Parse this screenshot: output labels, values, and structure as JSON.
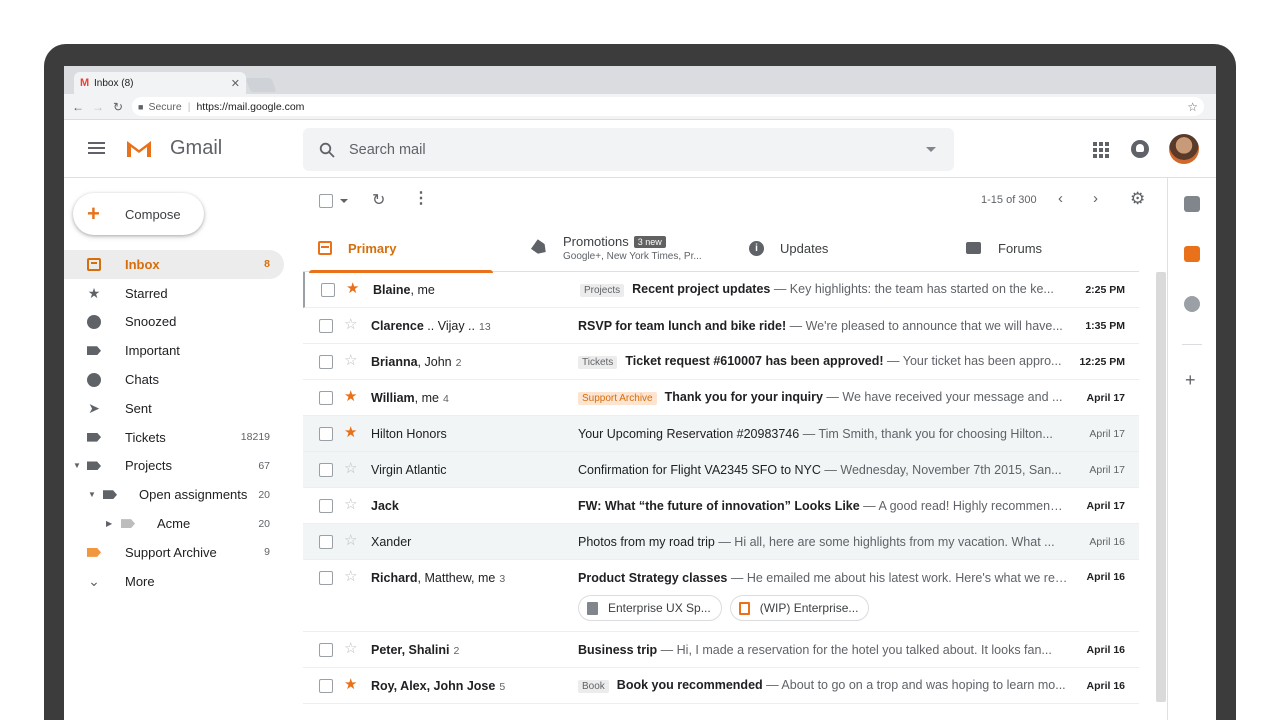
{
  "browser": {
    "tab_title": "Inbox (8)",
    "secure_label": "Secure",
    "url": "https://mail.google.com"
  },
  "app": {
    "name": "Gmail",
    "search_placeholder": "Search mail"
  },
  "compose_label": "Compose",
  "nav": [
    {
      "label": "Inbox",
      "count": "8"
    },
    {
      "label": "Starred",
      "count": ""
    },
    {
      "label": "Snoozed",
      "count": ""
    },
    {
      "label": "Important",
      "count": ""
    },
    {
      "label": "Chats",
      "count": ""
    },
    {
      "label": "Sent",
      "count": ""
    },
    {
      "label": "Tickets",
      "count": "18219"
    },
    {
      "label": "Projects",
      "count": "67"
    },
    {
      "label": "Open assignments",
      "count": "20"
    },
    {
      "label": "Acme",
      "count": "20"
    },
    {
      "label": "Support Archive",
      "count": "9"
    },
    {
      "label": "More",
      "count": ""
    }
  ],
  "toolbar": {
    "pagination": "1-15 of 300"
  },
  "tabs": {
    "primary": "Primary",
    "promotions": "Promotions",
    "promotions_badge": "3 new",
    "promotions_sub": "Google+, New York Times, Pr...",
    "updates": "Updates",
    "forums": "Forums"
  },
  "emails": [
    {
      "sender": "Blaine",
      "sender_rest": ", me",
      "count": "",
      "chip": "Projects",
      "subject": "Recent project updates",
      "snippet": " — Key highlights: the team has started on the ke...",
      "date": "2:25 PM"
    },
    {
      "sender": "Clarence",
      "sender_rest": " .. Vijay ..",
      "count": "13",
      "chip": "",
      "subject": "RSVP for team lunch and bike ride!",
      "snippet": " — We're pleased to announce that we will have...",
      "date": "1:35 PM"
    },
    {
      "sender": "Brianna",
      "sender_rest": ", John",
      "count": "2",
      "chip": "Tickets",
      "subject": "Ticket request #610007 has been approved!",
      "snippet": " — Your ticket has been appro...",
      "date": "12:25 PM"
    },
    {
      "sender": "William",
      "sender_rest": ", me",
      "count": "4",
      "chip": "Support Archive",
      "subject": "Thank you for your inquiry",
      "snippet": " — We have received your message and ...",
      "date": "April 17"
    },
    {
      "sender": "Hilton Honors",
      "sender_rest": "",
      "count": "",
      "chip": "",
      "subject": "Your Upcoming Reservation #20983746",
      "snippet": " — Tim Smith, thank you for choosing Hilton...",
      "date": "April 17"
    },
    {
      "sender": "Virgin Atlantic",
      "sender_rest": "",
      "count": "",
      "chip": "",
      "subject": "Confirmation for Flight VA2345 SFO to NYC",
      "snippet": " — Wednesday, November 7th 2015, San...",
      "date": "April 17"
    },
    {
      "sender": "Jack",
      "sender_rest": "",
      "count": "",
      "chip": "",
      "subject": "FW: What “the future of innovation” Looks Like",
      "snippet": " — A good read! Highly recommende...",
      "date": "April 17"
    },
    {
      "sender": "Xander",
      "sender_rest": "",
      "count": "",
      "chip": "",
      "subject": "Photos from my road trip",
      "snippet": " — Hi all, here are some highlights from my vacation. What ...",
      "date": "April 16"
    },
    {
      "sender": "Richard",
      "sender_rest": ", Matthew, me",
      "count": "3",
      "chip": "",
      "subject": "Product Strategy classes",
      "snippet": " — He emailed me about his latest work. Here's what we rev...",
      "date": "April 16",
      "attachments": [
        "Enterprise UX Sp...",
        "(WIP) Enterprise..."
      ]
    },
    {
      "sender": "Peter, Shalini",
      "sender_rest": "",
      "count": "2",
      "chip": "",
      "subject": "Business trip",
      "snippet": " — Hi, I made a reservation for the hotel you talked about. It looks fan...",
      "date": "April 16"
    },
    {
      "sender": "Roy, Alex, John Jose",
      "sender_rest": "",
      "count": "5",
      "chip": "Book",
      "subject": "Book you recommended",
      "snippet": " — About to go on a trop and was hoping to learn mo...",
      "date": "April 16"
    }
  ]
}
